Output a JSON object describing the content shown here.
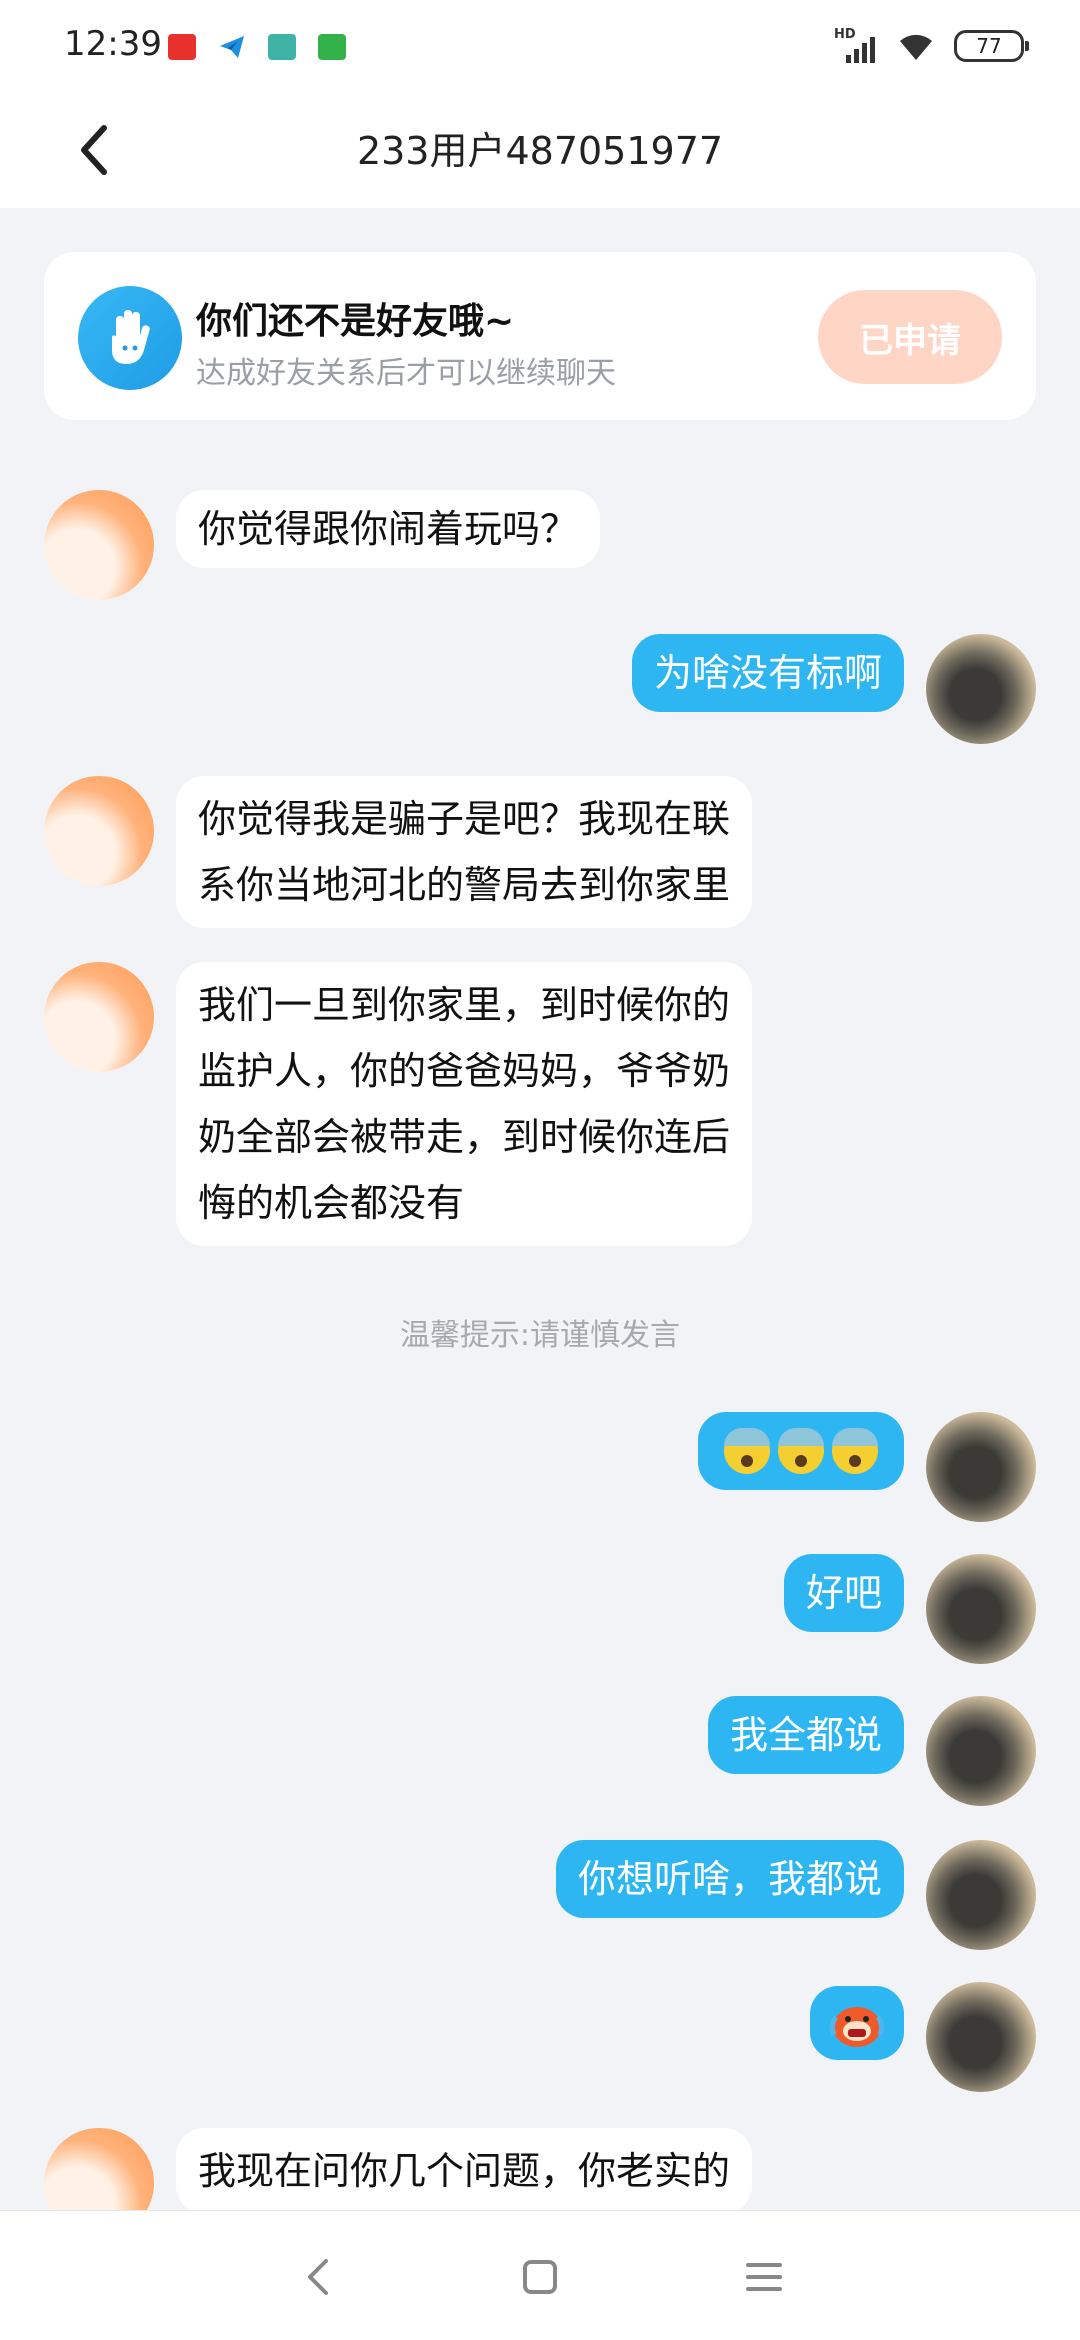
{
  "status_bar": {
    "time": "12:39",
    "battery": "77",
    "network_label": "HD"
  },
  "header": {
    "title": "233用户487051977"
  },
  "friend_notice": {
    "title": "你们还不是好友哦~",
    "subtitle": "达成好友关系后才可以继续聊天",
    "button_label": "已申请"
  },
  "messages": [
    {
      "sender": "other",
      "text": "你觉得跟你闹着玩吗？"
    },
    {
      "sender": "self",
      "text": "为啥没有标啊"
    },
    {
      "sender": "other",
      "lines": [
        "你觉得我是骗子是吧？我现在联",
        "系你当地河北的警局去到你家里"
      ]
    },
    {
      "sender": "other",
      "lines": [
        "我们一旦到你家里，到时候你的",
        "监护人，你的爸爸妈妈，爷爷奶",
        "奶全部会被带走，到时候你连后",
        "悔的机会都没有"
      ]
    },
    {
      "sender": "self",
      "emoji": "fearful-face-x3"
    },
    {
      "sender": "self",
      "text": "好吧"
    },
    {
      "sender": "self",
      "text": "我全都说"
    },
    {
      "sender": "self",
      "text": "你想听啥，我都说"
    },
    {
      "sender": "self",
      "emoji": "crying-sticker"
    },
    {
      "sender": "other",
      "text": "我现在问你几个问题，你老实的"
    }
  ],
  "system_hint": "温馨提示:请谨慎发言",
  "colors": {
    "accent": "#2eb6f2",
    "applied_button": "#ffd6c6",
    "background": "#f1f3f7"
  }
}
